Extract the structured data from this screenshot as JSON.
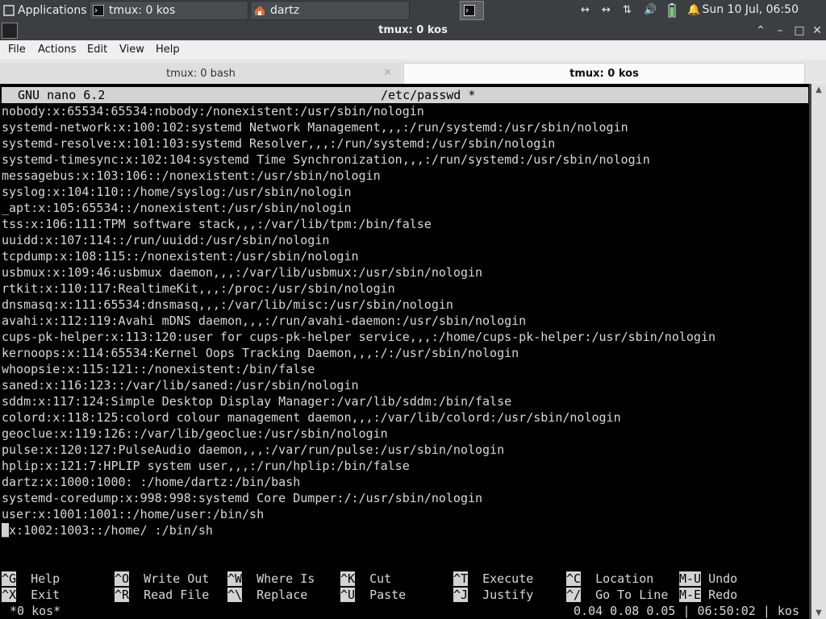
{
  "panel": {
    "applications_label": "Applications",
    "tasks": [
      {
        "label": "tmux: 0 kos"
      },
      {
        "label": "dartz"
      }
    ],
    "clock": "Sun 10 Jul, 06:50"
  },
  "window": {
    "title": "tmux: 0 kos"
  },
  "menubar": {
    "items": [
      "File",
      "Actions",
      "Edit",
      "View",
      "Help"
    ]
  },
  "tabs": [
    {
      "label": "tmux: 0 bash"
    },
    {
      "label": "tmux: 0 kos"
    }
  ],
  "nano": {
    "version": "GNU nano 6.2",
    "filename": "/etc/passwd *",
    "lines": [
      "nobody:x:65534:65534:nobody:/nonexistent:/usr/sbin/nologin",
      "systemd-network:x:100:102:systemd Network Management,,,:/run/systemd:/usr/sbin/nologin",
      "systemd-resolve:x:101:103:systemd Resolver,,,:/run/systemd:/usr/sbin/nologin",
      "systemd-timesync:x:102:104:systemd Time Synchronization,,,:/run/systemd:/usr/sbin/nologin",
      "messagebus:x:103:106::/nonexistent:/usr/sbin/nologin",
      "syslog:x:104:110::/home/syslog:/usr/sbin/nologin",
      "_apt:x:105:65534::/nonexistent:/usr/sbin/nologin",
      "tss:x:106:111:TPM software stack,,,:/var/lib/tpm:/bin/false",
      "uuidd:x:107:114::/run/uuidd:/usr/sbin/nologin",
      "tcpdump:x:108:115::/nonexistent:/usr/sbin/nologin",
      "usbmux:x:109:46:usbmux daemon,,,:/var/lib/usbmux:/usr/sbin/nologin",
      "rtkit:x:110:117:RealtimeKit,,,:/proc:/usr/sbin/nologin",
      "dnsmasq:x:111:65534:dnsmasq,,,:/var/lib/misc:/usr/sbin/nologin",
      "avahi:x:112:119:Avahi mDNS daemon,,,:/run/avahi-daemon:/usr/sbin/nologin",
      "cups-pk-helper:x:113:120:user for cups-pk-helper service,,,:/home/cups-pk-helper:/usr/sbin/nologin",
      "kernoops:x:114:65534:Kernel Oops Tracking Daemon,,,:/:/usr/sbin/nologin",
      "whoopsie:x:115:121::/nonexistent:/bin/false",
      "saned:x:116:123::/var/lib/saned:/usr/sbin/nologin",
      "sddm:x:117:124:Simple Desktop Display Manager:/var/lib/sddm:/bin/false",
      "colord:x:118:125:colord colour management daemon,,,:/var/lib/colord:/usr/sbin/nologin",
      "geoclue:x:119:126::/var/lib/geoclue:/usr/sbin/nologin",
      "pulse:x:120:127:PulseAudio daemon,,,:/var/run/pulse:/usr/sbin/nologin",
      "hplip:x:121:7:HPLIP system user,,,:/run/hplip:/bin/false",
      "dartz:x:1000:1000: :/home/dartz:/bin/bash",
      "systemd-coredump:x:998:998:systemd Core Dumper:/:/usr/sbin/nologin",
      "user:x:1001:1001::/home/user:/bin/sh"
    ],
    "cursor_line": {
      "cursor_char": "_",
      "rest": "x:1002:1003::/home/ :/bin/sh"
    },
    "shortcuts_row1": [
      {
        "key": "^G",
        "label": "Help"
      },
      {
        "key": "^O",
        "label": "Write Out"
      },
      {
        "key": "^W",
        "label": "Where Is"
      },
      {
        "key": "^K",
        "label": "Cut"
      },
      {
        "key": "^T",
        "label": "Execute"
      },
      {
        "key": "^C",
        "label": "Location"
      },
      {
        "key": "M-U",
        "label": "Undo"
      }
    ],
    "shortcuts_row2": [
      {
        "key": "^X",
        "label": "Exit"
      },
      {
        "key": "^R",
        "label": "Read File"
      },
      {
        "key": "^\\",
        "label": "Replace"
      },
      {
        "key": "^U",
        "label": "Paste"
      },
      {
        "key": "^J",
        "label": "Justify"
      },
      {
        "key": "^/",
        "label": "Go To Line"
      },
      {
        "key": "M-E",
        "label": "Redo"
      }
    ]
  },
  "tmux_status": {
    "left": "*0 kos*",
    "right": "0.04 0.08 0.05 | 06:50:02 | kos"
  },
  "colors": {
    "panel_bg": "#3b3f41",
    "terminal_bg": "#000000",
    "terminal_fg": "#d8d8d8",
    "highlight_bg": "#d3d3d3"
  },
  "icons": [
    "terminal-icon",
    "home-folder-icon",
    "network-icon",
    "transfer-icon",
    "volume-icon",
    "battery-icon",
    "notification-bell-icon"
  ]
}
